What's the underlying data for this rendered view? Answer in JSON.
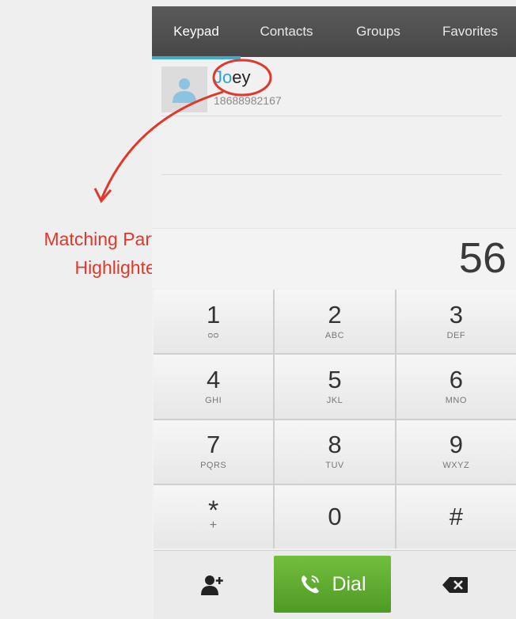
{
  "tabs": {
    "keypad": "Keypad",
    "contacts": "Contacts",
    "groups": "Groups",
    "favorites": "Favorites"
  },
  "contact": {
    "name_highlight": "Jo",
    "name_rest": "ey",
    "number": "18688982167"
  },
  "annotation": {
    "line1": "Matching Parts are",
    "line2": "Highlighted"
  },
  "dialed": "56",
  "keys": [
    {
      "num": "1",
      "sub": "ᴑᴑ"
    },
    {
      "num": "2",
      "sub": "ABC"
    },
    {
      "num": "3",
      "sub": "DEF"
    },
    {
      "num": "4",
      "sub": "GHI"
    },
    {
      "num": "5",
      "sub": "JKL"
    },
    {
      "num": "6",
      "sub": "MNO"
    },
    {
      "num": "7",
      "sub": "PQRS"
    },
    {
      "num": "8",
      "sub": "TUV"
    },
    {
      "num": "9",
      "sub": "WXYZ"
    },
    {
      "num": "*",
      "sub": "+"
    },
    {
      "num": "0",
      "sub": ""
    },
    {
      "num": "#",
      "sub": ""
    }
  ],
  "dial_label": "Dial",
  "colors": {
    "highlight": "#33a0d4",
    "annotation": "#e0382c",
    "dial_button": "#5fae2f",
    "tab_indicator": "#3fa9d2"
  },
  "icons": {
    "avatar": "person-icon",
    "add_contact": "add-contact-icon",
    "dial": "phone-icon",
    "delete": "backspace-icon"
  }
}
